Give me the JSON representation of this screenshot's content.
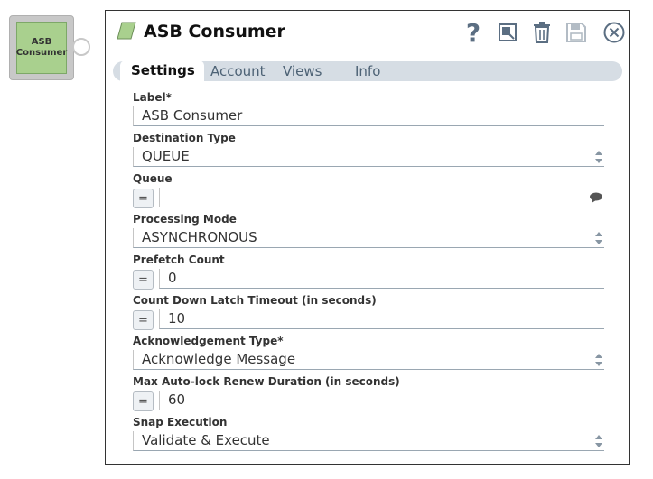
{
  "snap": {
    "label": "ASB Consumer"
  },
  "dialog": {
    "title": "ASB Consumer",
    "help_glyph": "?",
    "tabs": [
      "Settings",
      "Account",
      "Views",
      "Info"
    ],
    "fields": {
      "label": {
        "label": "Label*",
        "value": "ASB Consumer"
      },
      "destination_type": {
        "label": "Destination Type",
        "value": "QUEUE"
      },
      "queue": {
        "label": "Queue",
        "value": ""
      },
      "processing_mode": {
        "label": "Processing Mode",
        "value": "ASYNCHRONOUS"
      },
      "prefetch_count": {
        "label": "Prefetch Count",
        "value": "0"
      },
      "latch_timeout": {
        "label": "Count Down Latch Timeout (in seconds)",
        "value": "10"
      },
      "ack_type": {
        "label": "Acknowledgement Type*",
        "value": "Acknowledge Message"
      },
      "auto_lock": {
        "label": "Max Auto-lock Renew Duration (in seconds)",
        "value": "60"
      },
      "snap_execution": {
        "label": "Snap Execution",
        "value": "Validate & Execute"
      }
    },
    "expr_glyph": "="
  },
  "colors": {
    "accent": "#4d6275",
    "snap_green": "#a9d08e",
    "tab_bar": "#d6dde4"
  }
}
